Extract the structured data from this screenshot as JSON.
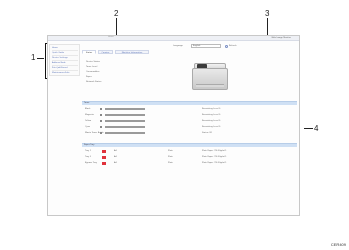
{
  "callouts": [
    "1",
    "2",
    "3",
    "4"
  ],
  "figure_code": "CER409",
  "topbar": {
    "breadcrumb": "Home",
    "link": "Web Image Monitor"
  },
  "sidebar": {
    "items": [
      {
        "label": "Home"
      },
      {
        "label": "Quick Guide"
      },
      {
        "label": "Device Settings"
      },
      {
        "label": "Address Book"
      },
      {
        "label": "Print Job/Stored"
      },
      {
        "label": "Maintenance/Info"
      }
    ]
  },
  "header": {
    "language_label": "Language",
    "language_value": "English",
    "refresh_label": "Refresh"
  },
  "tabs": [
    {
      "label": "Status"
    },
    {
      "label": "Counter"
    },
    {
      "label": "Machine Information"
    }
  ],
  "status": {
    "items": [
      "Device Status",
      "Toner Level",
      "Consumables",
      "Paper",
      "Network Status"
    ]
  },
  "colors": {
    "accent": "#5a73b8",
    "section": "#cfe0f4",
    "black": "#5a5a5a",
    "magenta": "#f3a6d6",
    "yellow": "#f3f08a",
    "cyan": "#9fe6f0",
    "waste": "#e8e8e8",
    "tray_red": "#e0323c"
  },
  "toner": {
    "header": "Toner",
    "rows": [
      {
        "label": "Black",
        "fill": 0.9,
        "color_key": "black",
        "status": "Remaining Level 5"
      },
      {
        "label": "Magenta",
        "fill": 0.9,
        "color_key": "magenta",
        "status": "Remaining Level 5"
      },
      {
        "label": "Yellow",
        "fill": 0.9,
        "color_key": "yellow",
        "status": "Remaining Level 5"
      },
      {
        "label": "Cyan",
        "fill": 0.9,
        "color_key": "cyan",
        "status": "Remaining Level 5"
      },
      {
        "label": "Waste Toner Bottle",
        "fill": 0.2,
        "color_key": "waste",
        "status": "Status OK"
      }
    ]
  },
  "tray": {
    "header": "Paper Tray",
    "rows": [
      {
        "label": "Tray 1",
        "size": "A4",
        "type": "Plain",
        "status": "Plain Paper (75-90g/m2)"
      },
      {
        "label": "Tray 2",
        "size": "A4",
        "type": "Plain",
        "status": "Plain Paper (75-90g/m2)"
      },
      {
        "label": "Bypass Tray",
        "size": "A4",
        "type": "Plain",
        "status": "Plain Paper (75-90g/m2)"
      }
    ]
  }
}
